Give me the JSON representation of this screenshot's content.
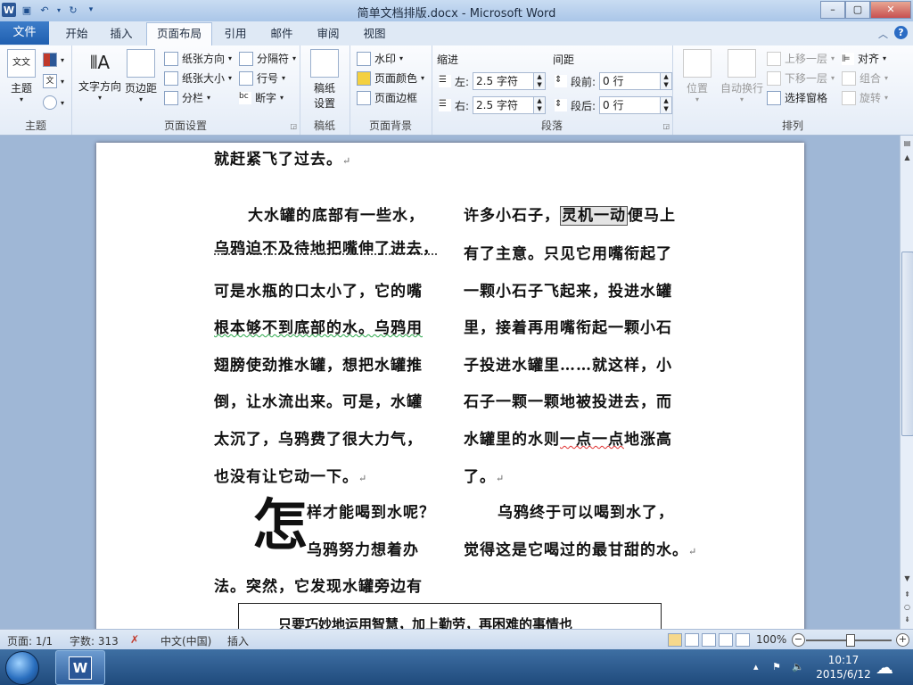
{
  "window": {
    "title": "简单文档排版.docx - Microsoft Word",
    "min_label": "–",
    "max_label": "▢",
    "close_label": "✕"
  },
  "tabs": {
    "file": "文件",
    "items": [
      "开始",
      "插入",
      "页面布局",
      "引用",
      "邮件",
      "审阅",
      "视图"
    ],
    "active": "页面布局"
  },
  "ribbon": {
    "theme_group": {
      "label": "主题",
      "btn_theme": "主题"
    },
    "page_setup": {
      "label": "页面设置",
      "btn_text_dir": "文字方向",
      "btn_margins": "页边距",
      "btn_orientation": "纸张方向",
      "btn_size": "纸张大小",
      "btn_columns": "分栏",
      "btn_breaks": "分隔符",
      "btn_line_numbers": "行号",
      "btn_hyphenation": "断字"
    },
    "draft_group": {
      "label": "稿纸",
      "btn": "稿纸\n设置",
      "btn_l1": "稿纸",
      "btn_l2": "设置"
    },
    "page_bg": {
      "label": "页面背景",
      "btn_watermark": "水印",
      "btn_page_color": "页面颜色",
      "btn_page_border": "页面边框"
    },
    "paragraph": {
      "label": "段落",
      "indent_title": "缩进",
      "spacing_title": "间距",
      "left_label": "左:",
      "right_label": "右:",
      "left_value": "2.5 字符",
      "right_value": "2.5 字符",
      "before_label": "段前:",
      "after_label": "段后:",
      "before_value": "0 行",
      "after_value": "0 行"
    },
    "arrange": {
      "label": "排列",
      "btn_position": "位置",
      "btn_wrap": "自动换行",
      "btn_forward": "上移一层",
      "btn_backward": "下移一层",
      "btn_selection_pane": "选择窗格",
      "btn_align": "对齐",
      "btn_group": "组合",
      "btn_rotate": "旋转"
    }
  },
  "document": {
    "top_line": "就赶紧飞了过去。",
    "left_col": [
      "大水罐的底部有一些水，",
      "乌鸦迫不及待地把嘴伸了进去，",
      "可是水瓶的口太小了，它的嘴",
      "根本够不到底部的水。乌鸦用",
      "翅膀使劲推水罐，想把水罐推",
      "倒，让水流出来。可是，水罐",
      "太沉了，乌鸦费了很大力气，",
      "也没有让它动一下。"
    ],
    "right_col_1_pre": "许多小石子，",
    "right_col_1_hl": "灵机一动",
    "right_col_1_post": "便马上",
    "right_col": [
      "有了主意。只见它用嘴衔起了",
      "一颗小石子飞起来，投进水罐",
      "里，接着再用嘴衔起一颗小石",
      "子投进水罐里……就这样，小",
      "石子一颗一颗地被投进去，而"
    ],
    "right_col_7_pre": "水罐里的水则",
    "right_col_7_sq": "一点一点",
    "right_col_7_post": "地涨高",
    "right_col_8": "了。",
    "dropcap": "怎",
    "dc_line1": "样才能喝到水呢？",
    "dc_line2": "乌鸦努力想着办",
    "dc_line3": "法。突然，它发现水罐旁边有",
    "right_end_1": "乌鸦终于可以喝到水了，",
    "right_end_2": "觉得这是它喝过的最甘甜的水。",
    "para_mark": "↵",
    "box_text": "只要巧妙地运用智慧，加上勤劳，再困难的事情也"
  },
  "status": {
    "page": "页面: 1/1",
    "words": "字数: 313",
    "language": "中文(中国)",
    "mode": "插入",
    "zoom": "100%"
  },
  "taskbar": {
    "time": "10:17",
    "date": "2015/6/12"
  }
}
